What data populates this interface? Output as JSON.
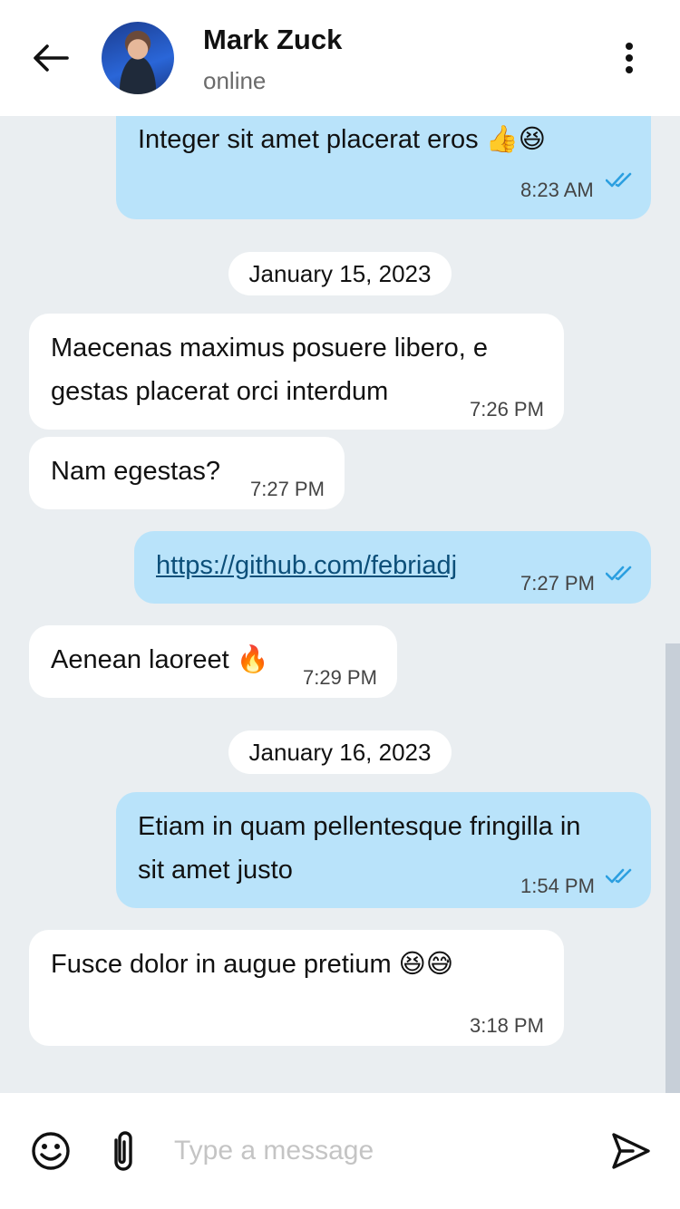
{
  "header": {
    "contact_name": "Mark Zuck",
    "status": "online"
  },
  "messages": [
    {
      "direction": "out",
      "text": "Integer sit amet placerat eros",
      "emoji": "👍😆",
      "time": "8:23 AM",
      "read": true
    },
    {
      "type": "date",
      "text": "January 15, 2023"
    },
    {
      "direction": "in",
      "text_line1": "Maecenas maximus posuere libero, e",
      "text_line2": "gestas placerat orci interdum",
      "time": "7:26 PM"
    },
    {
      "direction": "in",
      "text": "Nam egestas?",
      "time": "7:27 PM"
    },
    {
      "direction": "out",
      "link": "https://github.com/febriadj",
      "time": "7:27 PM",
      "read": true
    },
    {
      "direction": "in",
      "text": "Aenean laoreet",
      "emoji": "🔥",
      "time": "7:29 PM"
    },
    {
      "type": "date",
      "text": "January 16, 2023"
    },
    {
      "direction": "out",
      "text_line1": "Etiam in quam pellentesque fringilla in",
      "text_line2": "sit amet justo",
      "time": "1:54 PM",
      "read": true
    },
    {
      "direction": "in",
      "text": "Fusce dolor in augue pretium",
      "emoji": "😆😅",
      "time": "3:18 PM"
    }
  ],
  "composer": {
    "placeholder": "Type a message"
  },
  "colors": {
    "outgoing_bubble": "#b9e3fa",
    "incoming_bubble": "#ffffff",
    "chat_background": "#eaeef1",
    "read_ticks": "#2b9fe0",
    "link": "#0c4f79"
  },
  "icons": [
    "back-arrow-icon",
    "more-vertical-icon",
    "double-check-icon",
    "emoji-icon",
    "paperclip-icon",
    "send-icon"
  ]
}
